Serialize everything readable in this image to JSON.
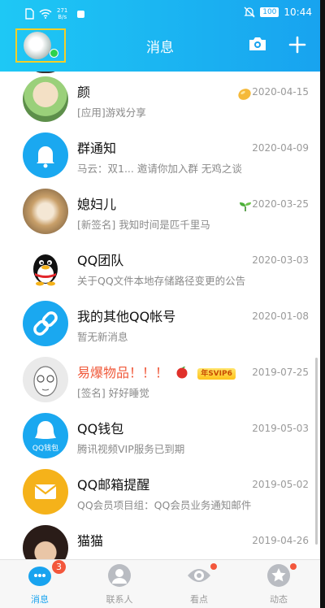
{
  "status_bar": {
    "net_speed_value": "271",
    "net_speed_unit": "B/s",
    "battery": "100",
    "time": "10:44"
  },
  "header": {
    "title": "消息"
  },
  "colors": {
    "header_start": "#1ec8f5",
    "header_end": "#18a3ef",
    "accent": "#18a3ef",
    "badge": "#f3573c",
    "svip_name": "#f0593a"
  },
  "conversations": [
    {
      "name": "颜",
      "preview": "[应用]游戏分享",
      "date": "2020-04-15",
      "badge_icon": "gold-bean-icon"
    },
    {
      "name": "群通知",
      "preview": "马云：双1... 邀请你加入群 无鸡之谈",
      "date": "2020-04-09"
    },
    {
      "name": "媳妇儿",
      "preview": "[新签名] 我知时间是匹千里马",
      "date": "2020-03-25",
      "badge_icon": "sprout-icon"
    },
    {
      "name": "QQ团队",
      "preview": "关于QQ文件本地存储路径变更的公告",
      "date": "2020-03-03"
    },
    {
      "name": "我的其他QQ帐号",
      "preview": "暂无新消息",
      "date": "2020-01-08"
    },
    {
      "name": "易爆物品！！！",
      "preview": "[签名] 好好睡觉",
      "date": "2019-07-25",
      "vip": "年SVIP6"
    },
    {
      "name": "QQ钱包",
      "preview": "腾讯视频VIP服务已到期",
      "date": "2019-05-03",
      "avatar_text": "QQ钱包"
    },
    {
      "name": "QQ邮箱提醒",
      "preview": "QQ会员项目组：QQ会员业务通知邮件",
      "date": "2019-05-02"
    },
    {
      "name": "猫猫",
      "preview": "",
      "date": "2019-04-26"
    }
  ],
  "tabs": [
    {
      "label": "消息",
      "badge": "3",
      "active": true
    },
    {
      "label": "联系人"
    },
    {
      "label": "看点"
    },
    {
      "label": "动态"
    }
  ]
}
